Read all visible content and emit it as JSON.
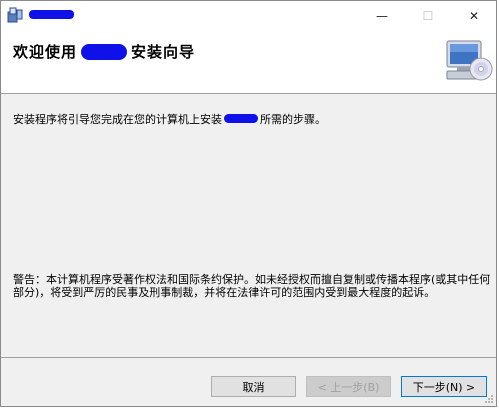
{
  "window": {
    "title": "",
    "minimize_glyph": "—",
    "maximize_glyph": "☐",
    "close_glyph": "✕"
  },
  "header": {
    "title_prefix": "欢迎使用",
    "title_suffix": "安装向导"
  },
  "body": {
    "intro_prefix": "安装程序将引导您完成在您的计算机上安装",
    "intro_suffix": "所需的步骤。",
    "warning": "警告：本计算机程序受著作权法和国际条约保护。如未经授权而擅自复制或传播本程序(或其中任何部分)，将受到严厉的民事及刑事制裁，并将在法律许可的范围内受到最大程度的起诉。"
  },
  "buttons": {
    "cancel": "取消",
    "back": "< 上一步(B)",
    "next": "下一步(N) >"
  },
  "colors": {
    "redaction": "#1010e8",
    "accent_border": "#0078d7"
  }
}
